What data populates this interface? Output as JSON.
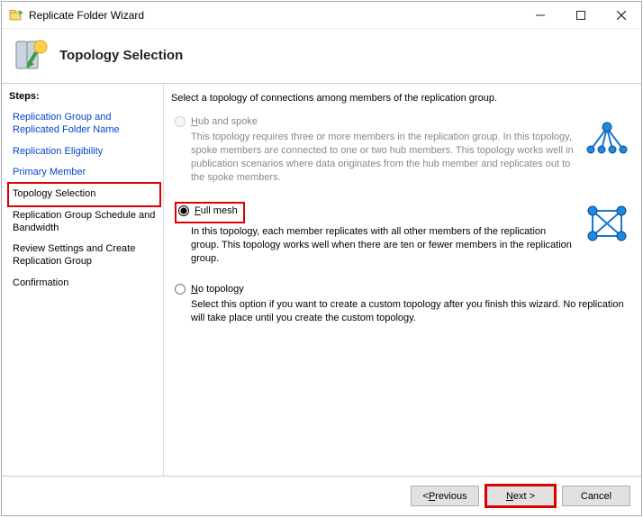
{
  "window": {
    "title": "Replicate Folder Wizard"
  },
  "header": {
    "title": "Topology Selection"
  },
  "sidebar": {
    "heading": "Steps:",
    "items": [
      {
        "label": "Replication Group and Replicated Folder Name"
      },
      {
        "label": "Replication Eligibility"
      },
      {
        "label": "Primary Member"
      },
      {
        "label": "Topology Selection"
      },
      {
        "label": "Replication Group Schedule and Bandwidth"
      },
      {
        "label": "Review Settings and Create Replication Group"
      },
      {
        "label": "Confirmation"
      }
    ]
  },
  "main": {
    "instruction": "Select a topology of connections among members of the replication group.",
    "options": {
      "hub": {
        "label_prefix": "H",
        "label_rest": "ub and spoke",
        "desc": "This topology requires three or more members in the replication group. In this topology, spoke members are connected to one or two hub members. This topology works well in publication scenarios where data originates from the hub member and replicates out to the spoke members."
      },
      "full": {
        "label_prefix": "F",
        "label_rest": "ull mesh",
        "desc": "In this topology, each member replicates with all other members of the replication group. This topology works well when there are ten or fewer members in the replication group."
      },
      "none": {
        "label_prefix": "N",
        "label_rest": "o topology",
        "desc": "Select this option if you want to create a custom topology after you finish this wizard. No replication will take place until you create the custom topology."
      }
    }
  },
  "footer": {
    "previous_prefix": "< ",
    "previous_ul": "P",
    "previous_rest": "revious",
    "next_ul": "N",
    "next_rest": "ext >",
    "cancel": "Cancel"
  }
}
